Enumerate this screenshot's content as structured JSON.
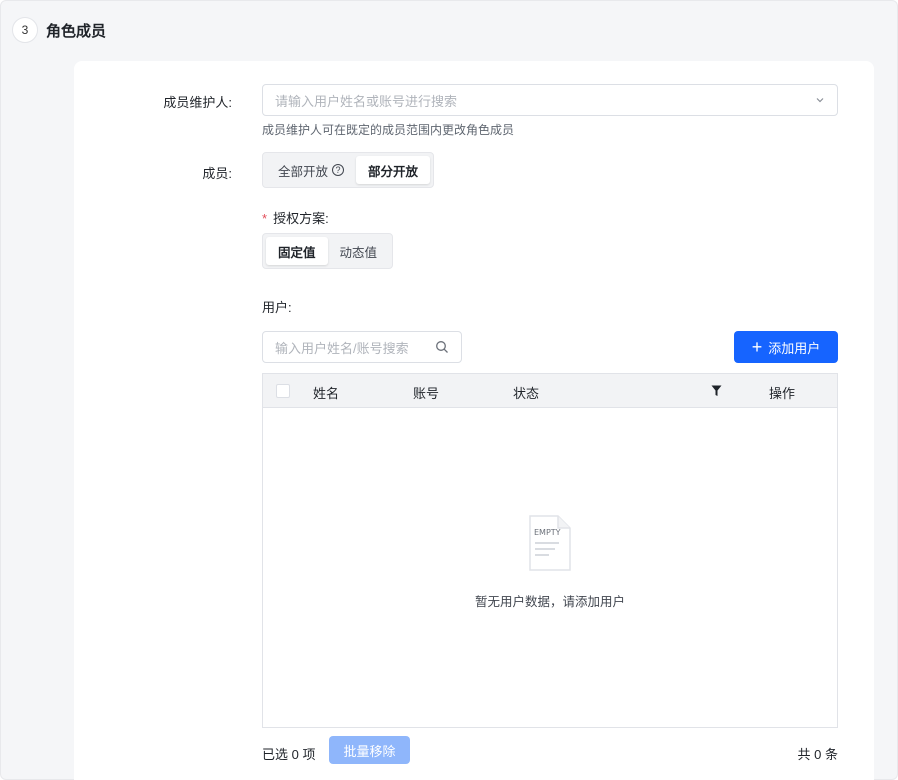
{
  "section": {
    "step": "3",
    "title": "角色成员"
  },
  "maintainer": {
    "label": "成员维护人:",
    "placeholder": "请输入用户姓名或账号进行搜索",
    "hint": "成员维护人可在既定的成员范围内更改角色成员"
  },
  "members": {
    "label": "成员:",
    "options": [
      "全部开放",
      "部分开放"
    ],
    "selected": "部分开放"
  },
  "auth": {
    "label": "授权方案:",
    "options": [
      "固定值",
      "动态值"
    ],
    "selected": "固定值"
  },
  "users": {
    "label": "用户:",
    "search_placeholder": "输入用户姓名/账号搜索",
    "add_label": "添加用户",
    "table": {
      "columns": [
        "姓名",
        "账号",
        "状态",
        "操作"
      ],
      "rows": [],
      "empty_icon_text": "EMPTY",
      "empty_text": "暂无用户数据，请添加用户"
    },
    "selected_count_text": "已选 0 项",
    "batch_remove_label": "批量移除",
    "total_text": "共 0 条"
  },
  "colors": {
    "primary": "#1664ff",
    "primary_disabled": "#8fb6fb",
    "required": "#e34d59"
  }
}
